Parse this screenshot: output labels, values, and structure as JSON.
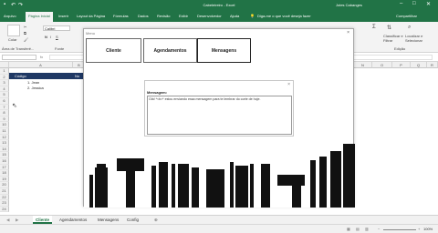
{
  "window": {
    "title": "Cabeleireiro - Excel",
    "user": "Jotes Cabanges",
    "controls": [
      "minimize-icon",
      "restore-icon",
      "close-icon"
    ]
  },
  "ribbon": {
    "tabs": [
      "Arquivo",
      "Página Inicial",
      "Inserir",
      "Layout da Página",
      "Fórmulas",
      "Dados",
      "Revisão",
      "Exibir",
      "Desenvolvedor",
      "Ajuda"
    ],
    "tell_me": "Diga-me o que você deseja fazer",
    "share": "Compartilhar",
    "paste_label": "Colar",
    "font_name": "Calibri",
    "group_clipboard": "Área de Transferê...",
    "group_font": "Fonte",
    "sort_label": "Classificar e Filtrar",
    "find_label": "Localizar e Selecionar",
    "group_edit": "Edição"
  },
  "formula_bar": {
    "name_box": "",
    "fx": "fx",
    "formula": ""
  },
  "sheet": {
    "columns": [
      "A",
      "B",
      "N",
      "O",
      "P",
      "Q",
      "R"
    ],
    "rows": [
      "1",
      "2",
      "3",
      "4",
      "5",
      "6",
      "7",
      "8",
      "9",
      "10",
      "11",
      "12",
      "13",
      "14",
      "15",
      "16",
      "17",
      "18",
      "19",
      "20",
      "21",
      "22",
      "23",
      "24"
    ],
    "header_cells": [
      "Código",
      "No"
    ],
    "data_rows": [
      "1. Jean",
      "2. Jessica"
    ]
  },
  "modal": {
    "title": "Menu",
    "buttons": [
      "Cliente",
      "Agendamentos",
      "Mensagens"
    ]
  },
  "message_box": {
    "label": "Mensagem:",
    "text": "Olá! *<b>* estou enviando essa mensagem para te lembrar do corte de hoje."
  },
  "sheet_tabs": [
    "Cliente",
    "Agendamentos",
    "Mensagens",
    "Config"
  ],
  "status_bar": {
    "zoom": "100%"
  },
  "colors": {
    "excel_green": "#217346",
    "ribbon_bg": "#f3f3f3",
    "header_fill": "#1f3864"
  }
}
